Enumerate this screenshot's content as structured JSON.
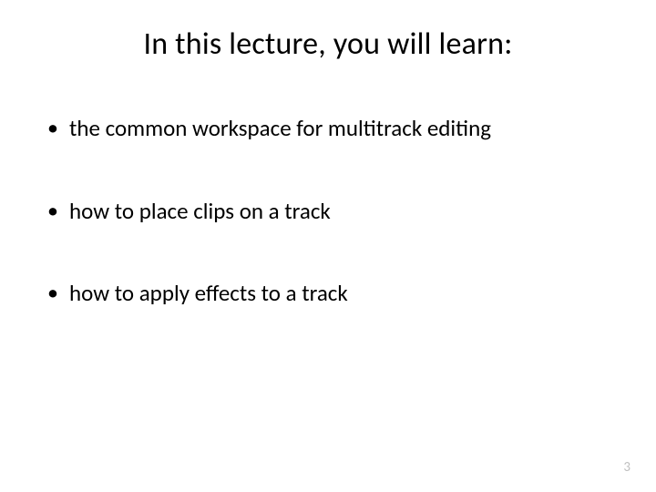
{
  "title": "In this lecture, you will learn:",
  "bullets": [
    "the common workspace for multitrack editing",
    "how to place clips on a track",
    "how to apply effects to a track"
  ],
  "page_number": "3"
}
